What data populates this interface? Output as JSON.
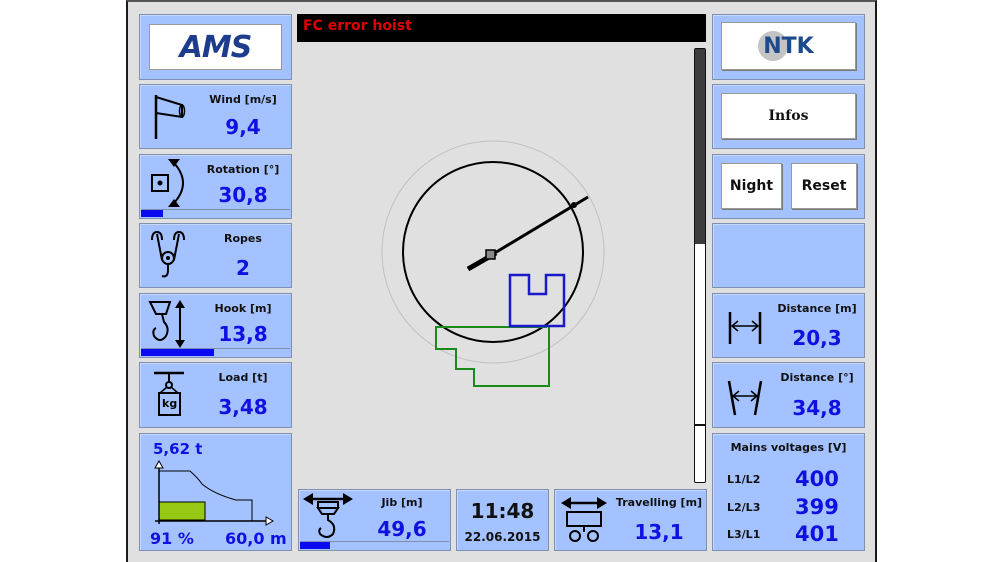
{
  "alarm": {
    "text": "FC error hoist",
    "color": "#e00000"
  },
  "logos": {
    "left": "AMS",
    "right": "NTK"
  },
  "left_panels": {
    "wind": {
      "label": "Wind [m/s]",
      "value": "9,4",
      "icon": "windsock-icon"
    },
    "rotation": {
      "label": "Rotation [°]",
      "value": "30,8",
      "icon": "rotation-icon",
      "bar_fraction": 0.15
    },
    "ropes": {
      "label": "Ropes",
      "value": "2",
      "icon": "pulley-hook-icon"
    },
    "hook": {
      "label": "Hook [m]",
      "value": "13,8",
      "icon": "hook-height-icon",
      "bar_fraction": 0.49
    },
    "load": {
      "label": "Load [t]",
      "value": "3,48",
      "icon": "load-weight-icon",
      "unit_glyph": "kg"
    },
    "load_chart": {
      "max_load": "5,62 t",
      "percent": "91 %",
      "radius": "60,0 m",
      "fill_fraction": 0.91
    }
  },
  "right_panels": {
    "infos_button": "Infos",
    "night_button": "Night",
    "reset_button": "Reset",
    "distance_m": {
      "label": "Distance [m]",
      "value": "20,3",
      "icon": "distance-linear-icon"
    },
    "distance_deg": {
      "label": "Distance [°]",
      "value": "34,8",
      "icon": "distance-angle-icon"
    },
    "mains": {
      "title": "Mains voltages [V]",
      "rows": [
        {
          "phase": "L1/L2",
          "value": "400"
        },
        {
          "phase": "L2/L3",
          "value": "399"
        },
        {
          "phase": "L3/L1",
          "value": "401"
        }
      ]
    }
  },
  "bottom_panels": {
    "jib": {
      "label": "Jib [m]",
      "value": "49,6",
      "icon": "trolley-hook-icon",
      "bar_fraction": 0.2
    },
    "clock": {
      "time": "11:48",
      "date": "22.06.2015"
    },
    "travelling": {
      "label": "Travelling [m]",
      "value": "13,1",
      "icon": "travel-carriage-icon"
    }
  },
  "scrollbar": {
    "thumb_fraction": 0.45,
    "position_fraction": 0.0
  },
  "crane_view": {
    "rotation_deg": 30.8,
    "colors": {
      "jib": "#000000",
      "zone_blue": "#1a1acc",
      "zone_green": "#1a8a1a",
      "outer_ring": "#c0c0c0"
    }
  }
}
